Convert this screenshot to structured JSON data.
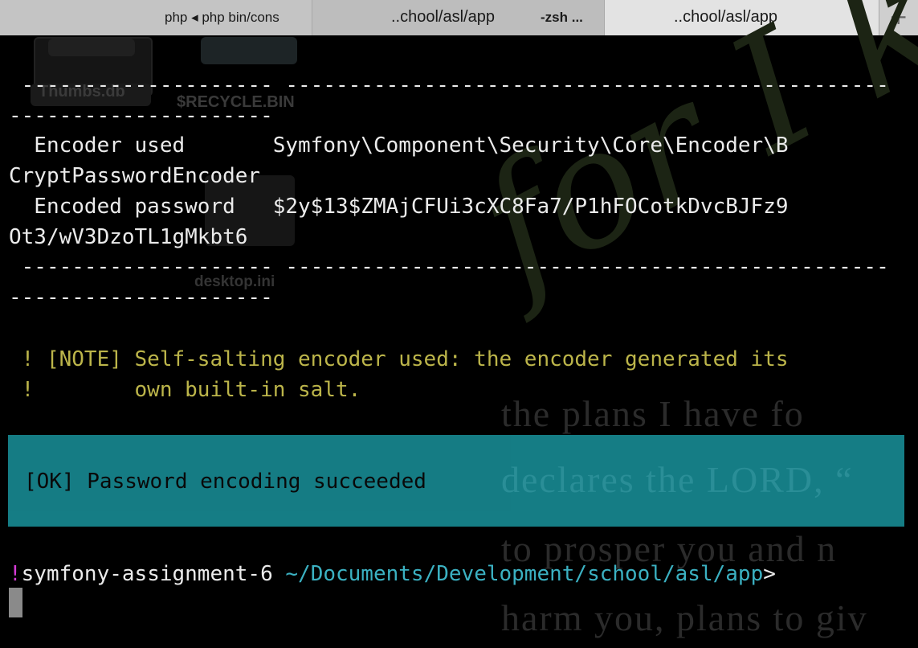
{
  "tabs": [
    {
      "label": "php ◂ php bin/cons",
      "active": false
    },
    {
      "label": "..chool/asl/app",
      "secondary": "-zsh ...",
      "active": false
    },
    {
      "label": "..chool/asl/app",
      "active": true
    }
  ],
  "new_tab_label": "+",
  "desktop": {
    "icons": [
      "Thumbs.db",
      "$RECYCLE.BIN",
      "desktop.ini"
    ],
    "wallpaper_script": "for I kn",
    "wallpaper_lines": [
      "the plans I have fo",
      "declares the LORD, “",
      "to prosper you and n",
      "harm you, plans to giv"
    ]
  },
  "terminal": {
    "rule_a": " -------------------- ------------------------------------------------",
    "rule_b": "---------------------",
    "row1_label": "  Encoder used       Symfony\\Component\\Security\\Core\\Encoder\\B",
    "row1_cont": "CryptPasswordEncoder",
    "row2_label": "  Encoded password   $2y$13$ZMAjCFUi3cXC8Fa7/P1hFOCotkDvcBJFz9",
    "row2_cont": "Ot3/wV3DzoTL1gMkbt6",
    "note_line1": " ! [NOTE] Self-salting encoder used: the encoder generated its",
    "note_line2": " !        own built-in salt.",
    "ok_message": "[OK] Password encoding succeeded",
    "prompt_bang": "!",
    "prompt_project": "symfony-assignment-6 ",
    "prompt_path": "~/Documents/Development/school/asl/app",
    "prompt_symbol": ">"
  },
  "colors": {
    "terminal_bg": "#000000",
    "note_text": "#bcb54a",
    "ok_bg": "#17868f",
    "prompt_bang": "#d43ad4",
    "prompt_path": "#3bb1c2"
  }
}
